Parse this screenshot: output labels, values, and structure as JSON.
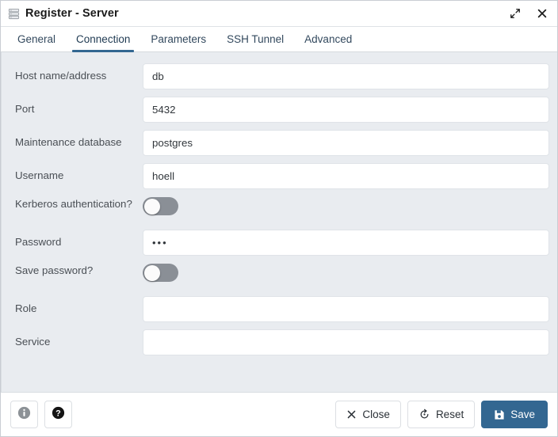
{
  "window": {
    "title": "Register - Server",
    "icon": "server-icon",
    "maximize_label": "Maximize",
    "close_label": "Close"
  },
  "tabs": [
    {
      "label": "General",
      "active": false
    },
    {
      "label": "Connection",
      "active": true
    },
    {
      "label": "Parameters",
      "active": false
    },
    {
      "label": "SSH Tunnel",
      "active": false
    },
    {
      "label": "Advanced",
      "active": false
    }
  ],
  "form": {
    "fields": [
      {
        "label": "Host name/address",
        "value": "db",
        "type": "text"
      },
      {
        "label": "Port",
        "value": "5432",
        "type": "text"
      },
      {
        "label": "Maintenance database",
        "value": "postgres",
        "type": "text"
      },
      {
        "label": "Username",
        "value": "hoell",
        "type": "text"
      },
      {
        "label": "Kerberos authentication?",
        "value": "off",
        "type": "toggle"
      },
      {
        "label": "Password",
        "value": "•••",
        "type": "password"
      },
      {
        "label": "Save password?",
        "value": "off",
        "type": "toggle"
      },
      {
        "label": "Role",
        "value": "",
        "type": "text"
      },
      {
        "label": "Service",
        "value": "",
        "type": "text"
      }
    ]
  },
  "footer": {
    "info_label": "i",
    "help_label": "?",
    "close_label": "Close",
    "reset_label": "Reset",
    "save_label": "Save"
  },
  "colors": {
    "accent": "#336791",
    "body_background": "#e9ecf0",
    "toggle_track_off": "#8a8f96"
  }
}
